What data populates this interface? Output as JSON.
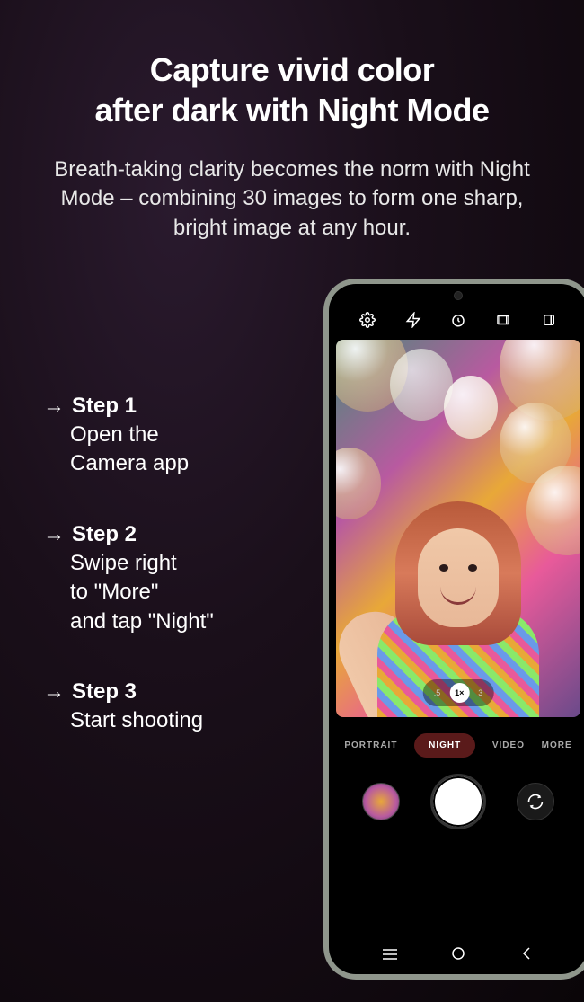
{
  "title": "Capture vivid color\nafter dark with Night Mode",
  "subtitle": "Breath-taking clarity becomes the norm with Night Mode – combining 30 images to form one sharp, bright image at any hour.",
  "steps": [
    {
      "label": "Step 1",
      "body": "Open the\nCamera app"
    },
    {
      "label": "Step 2",
      "body": "Swipe right\nto \"More\"\nand tap \"Night\""
    },
    {
      "label": "Step 3",
      "body": "Start shooting"
    }
  ],
  "arrow": "→",
  "phone": {
    "toolbar_icons": [
      "settings-icon",
      "flash-icon",
      "timer-icon",
      "ratio-icon",
      "effects-icon"
    ],
    "zoom": {
      "options": [
        ".5",
        "1×",
        "3"
      ],
      "active_index": 1
    },
    "modes": [
      "PORTRAIT",
      "NIGHT",
      "VIDEO",
      "MORE"
    ],
    "active_mode_index": 1,
    "nav": [
      "recents",
      "home",
      "back"
    ]
  }
}
